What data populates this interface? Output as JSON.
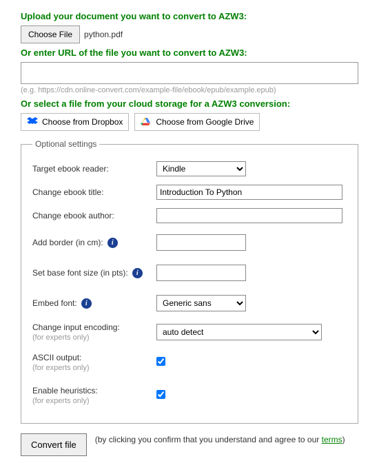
{
  "upload": {
    "heading": "Upload your document you want to convert to AZW3:",
    "choose_label": "Choose File",
    "file_name": "python.pdf"
  },
  "url": {
    "heading": "Or enter URL of the file you want to convert to AZW3:",
    "value": "",
    "hint": "(e.g. https://cdn.online-convert.com/example-file/ebook/epub/example.epub)"
  },
  "cloud": {
    "heading": "Or select a file from your cloud storage for a AZW3 conversion:",
    "dropbox_label": "Choose from Dropbox",
    "gdrive_label": "Choose from Google Drive"
  },
  "optional": {
    "legend": "Optional settings",
    "target_reader": {
      "label": "Target ebook reader:",
      "value": "Kindle"
    },
    "title": {
      "label": "Change ebook title:",
      "value": "Introduction To Python"
    },
    "author": {
      "label": "Change ebook author:",
      "value": ""
    },
    "border": {
      "label": "Add border (in cm):",
      "value": ""
    },
    "font_size": {
      "label": "Set base font size (in pts):",
      "value": ""
    },
    "embed_font": {
      "label": "Embed font:",
      "value": "Generic sans"
    },
    "encoding": {
      "label": "Change input encoding:",
      "sub": "(for experts only)",
      "value": "auto detect"
    },
    "ascii": {
      "label": "ASCII output:",
      "sub": "(for experts only)",
      "checked": true
    },
    "heuristics": {
      "label": "Enable heuristics:",
      "sub": "(for experts only)",
      "checked": true
    }
  },
  "footer": {
    "convert_label": "Convert file",
    "note_pre": "(by clicking you confirm that you understand and agree to our ",
    "terms": "terms",
    "note_post": ")"
  }
}
